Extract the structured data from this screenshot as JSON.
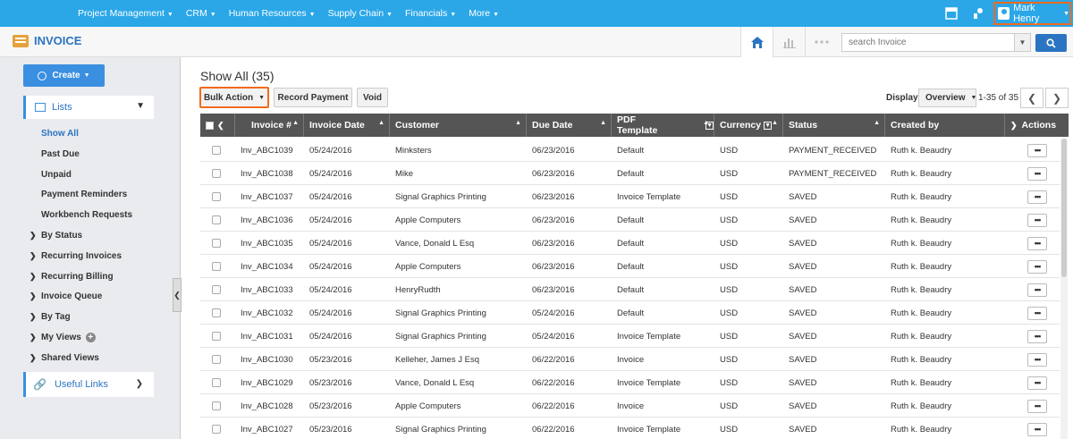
{
  "topnav": {
    "menu": [
      "Project Management",
      "CRM",
      "Human Resources",
      "Supply Chain",
      "Financials",
      "More"
    ],
    "user_name": "Mark Henry"
  },
  "app": {
    "title": "INVOICE"
  },
  "search": {
    "placeholder": "search Invoice"
  },
  "sidebar": {
    "create_label": "Create",
    "lists_label": "Lists",
    "items": [
      {
        "label": "Show All",
        "active": true,
        "expandable": false
      },
      {
        "label": "Past Due",
        "active": false,
        "expandable": false
      },
      {
        "label": "Unpaid",
        "active": false,
        "expandable": false
      },
      {
        "label": "Payment Reminders",
        "active": false,
        "expandable": false
      },
      {
        "label": "Workbench Requests",
        "active": false,
        "expandable": false
      },
      {
        "label": "By Status",
        "active": false,
        "expandable": true
      },
      {
        "label": "Recurring Invoices",
        "active": false,
        "expandable": true
      },
      {
        "label": "Recurring Billing",
        "active": false,
        "expandable": true
      },
      {
        "label": "Invoice Queue",
        "active": false,
        "expandable": true
      },
      {
        "label": "By Tag",
        "active": false,
        "expandable": true
      },
      {
        "label": "My Views",
        "active": false,
        "expandable": true
      },
      {
        "label": "Shared Views",
        "active": false,
        "expandable": true
      }
    ],
    "useful_links_label": "Useful Links"
  },
  "main": {
    "title": "Show All (35)",
    "bulk_action_label": "Bulk Action",
    "record_payment_label": "Record Payment",
    "void_label": "Void",
    "display_label": "Display",
    "display_value": "Overview",
    "page_info": "1-35 of 35"
  },
  "grid": {
    "columns": [
      "Invoice #",
      "Invoice Date",
      "Customer",
      "Due Date",
      "PDF Template",
      "Currency",
      "Status",
      "Created by",
      "Actions"
    ],
    "rows": [
      [
        "Inv_ABC1039",
        "05/24/2016",
        "Minksters",
        "06/23/2016",
        "Default",
        "USD",
        "PAYMENT_RECEIVED",
        "Ruth k. Beaudry"
      ],
      [
        "Inv_ABC1038",
        "05/24/2016",
        "Mike",
        "06/23/2016",
        "Default",
        "USD",
        "PAYMENT_RECEIVED",
        "Ruth k. Beaudry"
      ],
      [
        "Inv_ABC1037",
        "05/24/2016",
        "Signal Graphics Printing",
        "06/23/2016",
        "Invoice Template",
        "USD",
        "SAVED",
        "Ruth k. Beaudry"
      ],
      [
        "Inv_ABC1036",
        "05/24/2016",
        "Apple Computers",
        "06/23/2016",
        "Default",
        "USD",
        "SAVED",
        "Ruth k. Beaudry"
      ],
      [
        "Inv_ABC1035",
        "05/24/2016",
        "Vance, Donald L Esq",
        "06/23/2016",
        "Default",
        "USD",
        "SAVED",
        "Ruth k. Beaudry"
      ],
      [
        "Inv_ABC1034",
        "05/24/2016",
        "Apple Computers",
        "06/23/2016",
        "Default",
        "USD",
        "SAVED",
        "Ruth k. Beaudry"
      ],
      [
        "Inv_ABC1033",
        "05/24/2016",
        "HenryRudth",
        "06/23/2016",
        "Default",
        "USD",
        "SAVED",
        "Ruth k. Beaudry"
      ],
      [
        "Inv_ABC1032",
        "05/24/2016",
        "Signal Graphics Printing",
        "05/24/2016",
        "Default",
        "USD",
        "SAVED",
        "Ruth k. Beaudry"
      ],
      [
        "Inv_ABC1031",
        "05/24/2016",
        "Signal Graphics Printing",
        "05/24/2016",
        "Invoice Template",
        "USD",
        "SAVED",
        "Ruth k. Beaudry"
      ],
      [
        "Inv_ABC1030",
        "05/23/2016",
        "Kelleher, James J Esq",
        "06/22/2016",
        "Invoice",
        "USD",
        "SAVED",
        "Ruth k. Beaudry"
      ],
      [
        "Inv_ABC1029",
        "05/23/2016",
        "Vance, Donald L Esq",
        "06/22/2016",
        "Invoice Template",
        "USD",
        "SAVED",
        "Ruth k. Beaudry"
      ],
      [
        "Inv_ABC1028",
        "05/23/2016",
        "Apple Computers",
        "06/22/2016",
        "Invoice",
        "USD",
        "SAVED",
        "Ruth k. Beaudry"
      ],
      [
        "Inv_ABC1027",
        "05/23/2016",
        "Signal Graphics Printing",
        "06/22/2016",
        "Invoice Template",
        "USD",
        "SAVED",
        "Ruth k. Beaudry"
      ]
    ],
    "action_glyph": "•••"
  },
  "colors": {
    "topbar": "#2ba7e8",
    "accent": "#2b74c2",
    "highlight": "#f26b1d",
    "header": "#555555"
  }
}
